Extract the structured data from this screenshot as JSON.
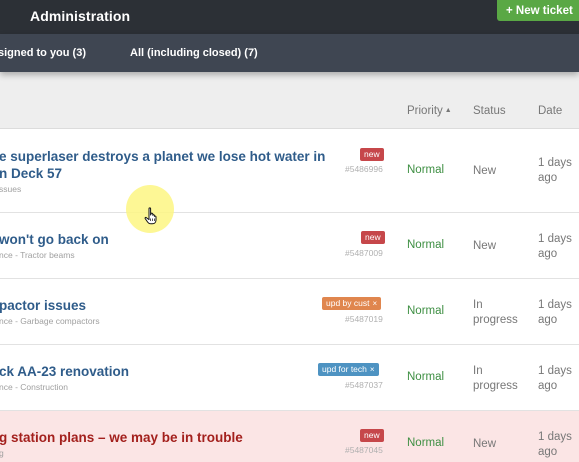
{
  "header": {
    "title": "Administration",
    "new_ticket_label": "+ New ticket"
  },
  "tabs": [
    {
      "label": "signed to you (3)"
    },
    {
      "label": "All (including closed) (7)"
    }
  ],
  "columns": {
    "priority": "Priority",
    "status": "Status",
    "date": "Date",
    "sort_icon": "sort-ascending-icon"
  },
  "tickets": [
    {
      "title_line1": "e superlaser destroys a planet we lose hot water in",
      "title_line2": "n Deck 57",
      "subtitle": "ssues",
      "badge": "new",
      "number": "#5486996",
      "priority": "Normal",
      "status_line1": "New",
      "status_line2": "",
      "date_line1": "1 days",
      "date_line2": "ago"
    },
    {
      "title_line1": "won't go back on",
      "subtitle": "nce - Tractor beams",
      "badge": "new",
      "number": "#5487009",
      "priority": "Normal",
      "status_line1": "New",
      "status_line2": "",
      "date_line1": "1 days",
      "date_line2": "ago"
    },
    {
      "title_line1": "pactor issues",
      "subtitle": "nce - Garbage compactors",
      "badge": "upd by cust",
      "badge_close": "×",
      "number": "#5487019",
      "priority": "Normal",
      "status_line1": "In",
      "status_line2": "progress",
      "date_line1": "1 days",
      "date_line2": "ago"
    },
    {
      "title_line1": "ck AA-23 renovation",
      "subtitle": "nce - Construction",
      "badge": "upd for tech",
      "badge_close": "×",
      "number": "#5487037",
      "priority": "Normal",
      "status_line1": "In",
      "status_line2": "progress",
      "date_line1": "1 days",
      "date_line2": "ago"
    },
    {
      "title_line1": "g station plans – we may be in trouble",
      "subtitle": "g",
      "badge": "new",
      "number": "#5487045",
      "priority": "Normal",
      "status_line1": "New",
      "status_line2": "",
      "date_line1": "1 days",
      "date_line2": "ago"
    }
  ],
  "colors": {
    "topbar": "#2c3036",
    "tabbar": "#3f4652",
    "new_ticket": "#5aa845",
    "title_link": "#2f5c8a",
    "priority_normal": "#3e8f43",
    "badge_new": "#c6474a",
    "badge_upd_by_cust": "#e0864e",
    "badge_upd_for_tech": "#4e93c2",
    "alert_row_bg": "#fbe5e5",
    "alert_title": "#a3201d",
    "cursor_highlight": "#fdf682"
  }
}
